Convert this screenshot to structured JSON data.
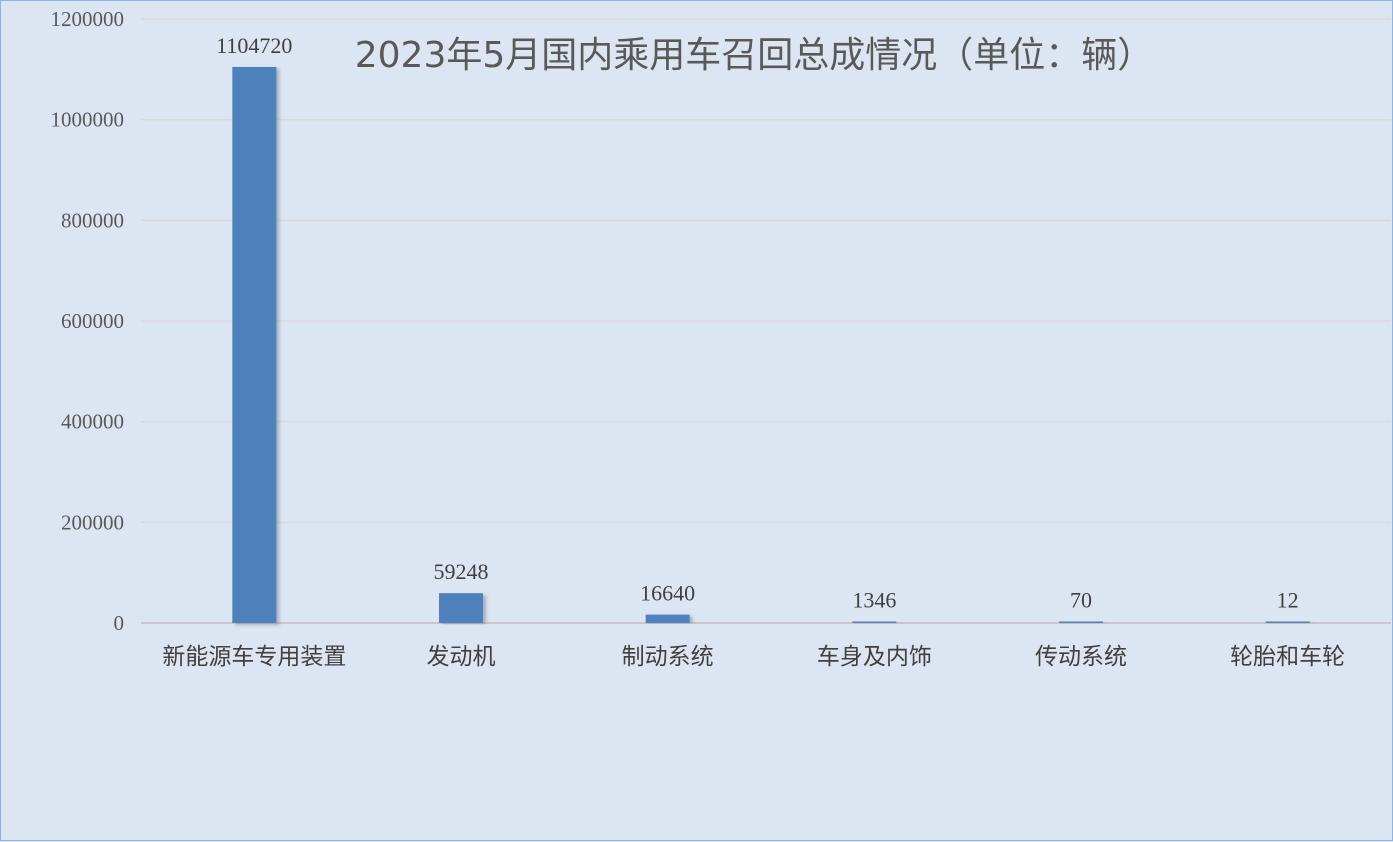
{
  "chart_data": {
    "type": "bar",
    "title": "2023年5月国内乘用车召回总成情况（单位：辆）",
    "categories": [
      "新能源车专用装置",
      "发动机",
      "制动系统",
      "车身及内饰",
      "传动系统",
      "轮胎和车轮"
    ],
    "values": [
      1104720,
      59248,
      16640,
      1346,
      70,
      12
    ],
    "ylim": [
      0,
      1200000
    ],
    "yticks": [
      "0",
      "200000",
      "400000",
      "600000",
      "800000",
      "1000000",
      "1200000"
    ],
    "grid": true,
    "legend": "none",
    "bar_color": "#4f81bd",
    "background_color": "#dce6f2",
    "gridline_color": "#d9d9d9"
  }
}
